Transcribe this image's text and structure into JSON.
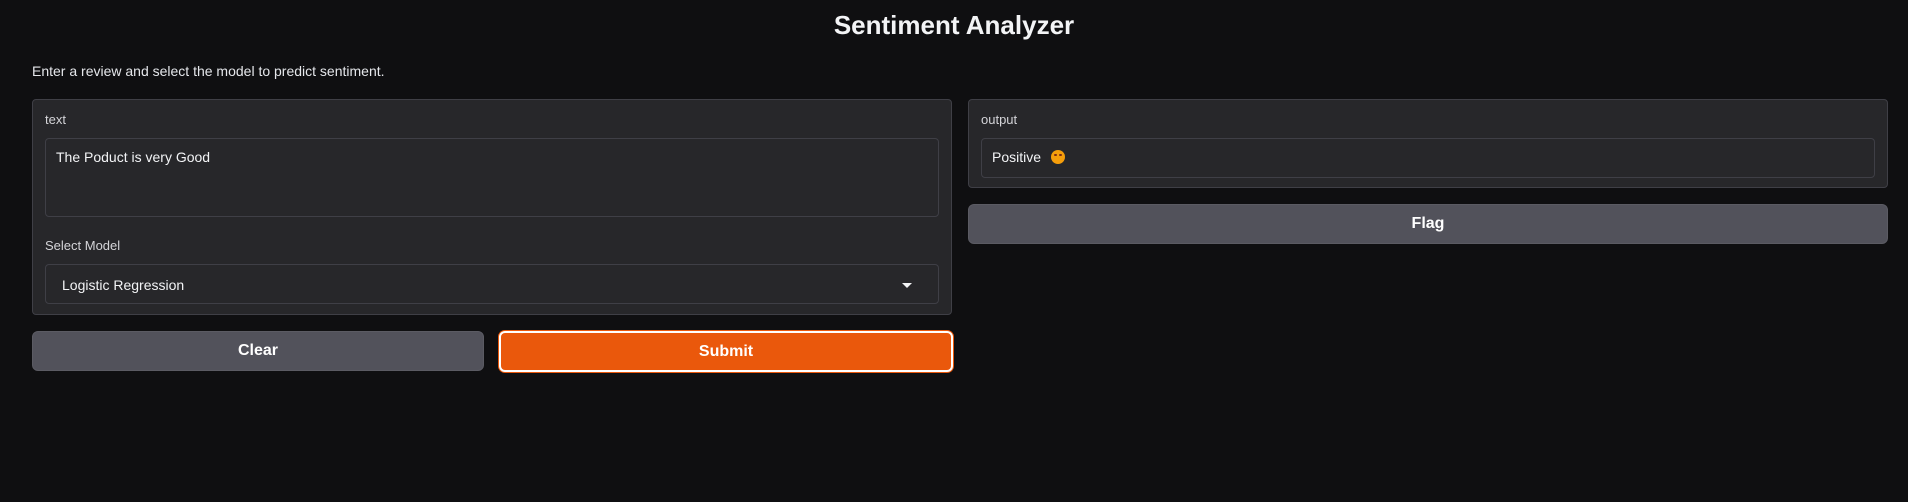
{
  "header": {
    "title": "Sentiment Analyzer",
    "description": "Enter a review and select the model to predict sentiment."
  },
  "input_panel": {
    "text_label": "text",
    "text_value": "The Poduct is very Good",
    "model_label": "Select Model",
    "model_value": "Logistic Regression",
    "model_icon": "chevron-down-icon"
  },
  "output_panel": {
    "label": "output",
    "value": "Positive",
    "value_icon": "smiling-face-emoji-icon"
  },
  "buttons": {
    "clear_label": "Clear",
    "submit_label": "Submit",
    "flag_label": "Flag"
  },
  "colors": {
    "background": "#0f0f11",
    "panel": "#27272a",
    "primary": "#ea580c",
    "secondary": "#52525b"
  }
}
